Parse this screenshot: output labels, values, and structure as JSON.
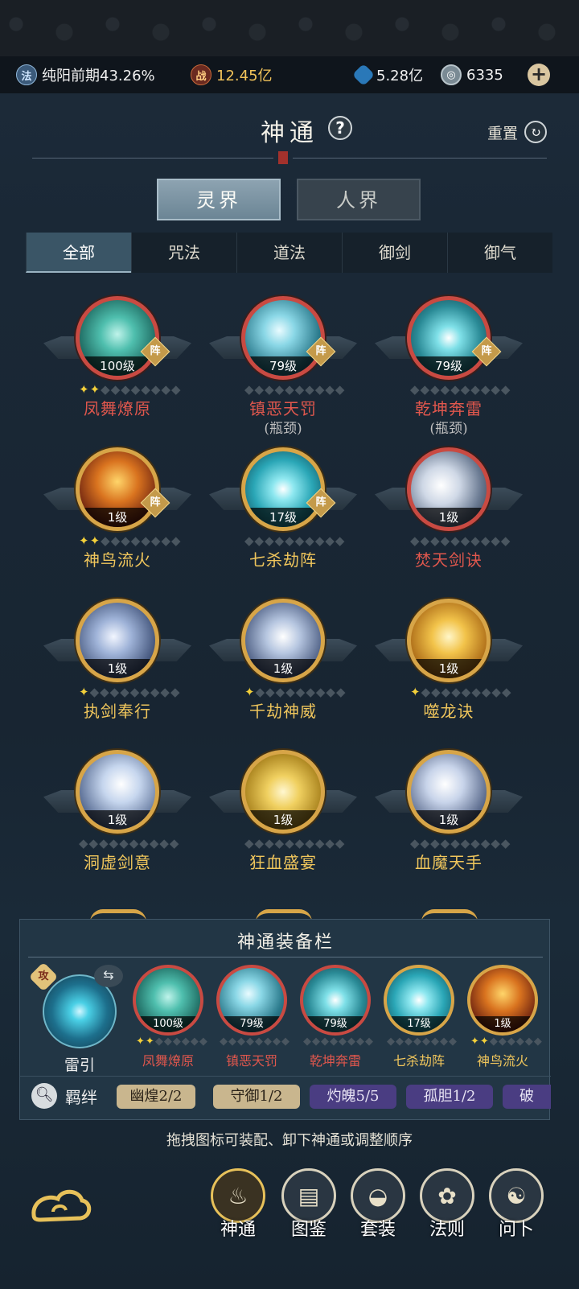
{
  "resources": {
    "realm_icon": "法",
    "realm_text": "纯阳前期43.26%",
    "power_icon": "战",
    "power_value": "12.45亿",
    "gem_value": "5.28亿",
    "coin_value": "6335",
    "plus": "+"
  },
  "header": {
    "title": "神通",
    "help": "?",
    "reset_label": "重置"
  },
  "realms": [
    "灵界",
    "人界"
  ],
  "tabs": [
    "全部",
    "咒法",
    "道法",
    "御剑",
    "御气"
  ],
  "skills": [
    {
      "name": "凤舞燎原",
      "level": "100级",
      "zhen": "阵",
      "stars": 2,
      "note": ""
    },
    {
      "name": "镇恶天罚",
      "level": "79级",
      "zhen": "阵",
      "stars": 0,
      "note": "(瓶颈)"
    },
    {
      "name": "乾坤奔雷",
      "level": "79级",
      "zhen": "阵",
      "stars": 0,
      "note": "(瓶颈)"
    },
    {
      "name": "神鸟流火",
      "level": "1级",
      "zhen": "阵",
      "stars": 2,
      "note": ""
    },
    {
      "name": "七杀劫阵",
      "level": "17级",
      "zhen": "阵",
      "stars": 0,
      "note": ""
    },
    {
      "name": "焚天剑诀",
      "level": "1级",
      "zhen": "",
      "stars": 0,
      "note": ""
    },
    {
      "name": "执剑奉行",
      "level": "1级",
      "zhen": "",
      "stars": 1,
      "note": ""
    },
    {
      "name": "千劫神威",
      "level": "1级",
      "zhen": "",
      "stars": 1,
      "note": ""
    },
    {
      "name": "噬龙诀",
      "level": "1级",
      "zhen": "",
      "stars": 1,
      "note": ""
    },
    {
      "name": "洞虚剑意",
      "level": "1级",
      "zhen": "",
      "stars": 0,
      "note": ""
    },
    {
      "name": "狂血盛宴",
      "level": "1级",
      "zhen": "",
      "stars": 0,
      "note": ""
    },
    {
      "name": "血魔天手",
      "level": "1级",
      "zhen": "",
      "stars": 0,
      "note": ""
    }
  ],
  "equip": {
    "title": "神通装备栏",
    "lead_name": "雷引",
    "lead_badge": "攻",
    "swap": "⇆",
    "slots": [
      {
        "name": "凤舞燎原",
        "level": "100级",
        "stars": 2
      },
      {
        "name": "镇恶天罚",
        "level": "79级",
        "stars": 0
      },
      {
        "name": "乾坤奔雷",
        "level": "79级",
        "stars": 0
      },
      {
        "name": "七杀劫阵",
        "level": "17级",
        "stars": 0
      },
      {
        "name": "神鸟流火",
        "level": "1级",
        "stars": 2
      }
    ],
    "bond_label": "羁绊",
    "bonds": [
      "幽煌2/2",
      "守御1/2",
      "灼魄5/5",
      "孤胆1/2",
      "破"
    ]
  },
  "hint": "拖拽图标可装配、卸下神通或调整顺序",
  "nav": [
    "神通",
    "图鉴",
    "套装",
    "法则",
    "问卜"
  ],
  "colors": {
    "red_name": "#e0574d",
    "gold_name": "#f0c65c",
    "star_lit": "#f2cf3a"
  }
}
